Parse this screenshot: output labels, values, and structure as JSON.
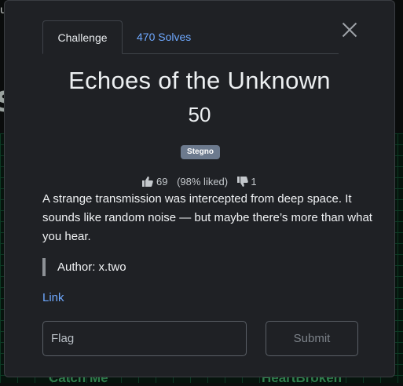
{
  "background": {
    "top_letter": "u",
    "side_letter": "S",
    "cards": [
      "Catch Me",
      "HeartBroken"
    ]
  },
  "modal": {
    "tabs": {
      "challenge": "Challenge",
      "solves": "470 Solves"
    },
    "close_icon": "close-icon",
    "title": "Echoes of the Unknown",
    "points": "50",
    "category_badge": "Stegno",
    "votes": {
      "likes": "69",
      "liked_percent": "(98% liked)",
      "dislikes": "1"
    },
    "description": "A strange transmission was intercepted from deep space. It sounds like random noise — but maybe there’s more than what you hear.",
    "author": "Author: x.two",
    "link_label": "Link",
    "flag_placeholder": "Flag",
    "submit_label": "Submit",
    "colors": {
      "accent": "#6ea8fe",
      "badge": "#6c7a8e",
      "modal_bg": "#1f2125"
    }
  }
}
